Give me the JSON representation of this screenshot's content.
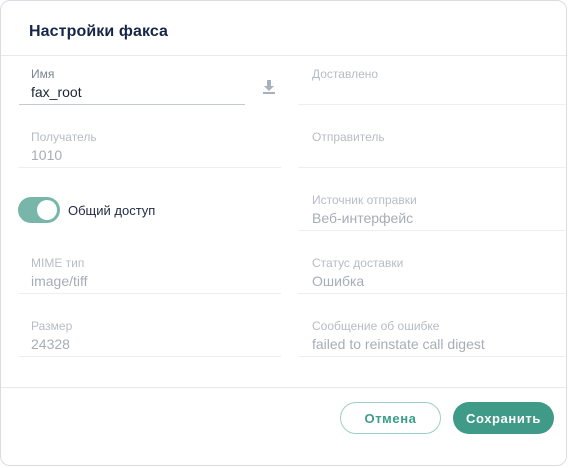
{
  "dialog": {
    "title": "Настройки факса"
  },
  "fields": {
    "name": {
      "label": "Имя",
      "value": "fax_root"
    },
    "delivered": {
      "label": "Доставлено",
      "value": ""
    },
    "recipient": {
      "label": "Получатель",
      "value": "1010"
    },
    "sender": {
      "label": "Отправитель",
      "value": ""
    },
    "send_source": {
      "label": "Источник отправки",
      "value": "Веб-интерфейс"
    },
    "mime_type": {
      "label": "MIME тип",
      "value": "image/tiff"
    },
    "delivery_status": {
      "label": "Статус доставки",
      "value": "Ошибка"
    },
    "size": {
      "label": "Размер",
      "value": "24328"
    },
    "error_message": {
      "label": "Сообщение об ошибке",
      "value": "failed to reinstate call digest"
    }
  },
  "shared_access": {
    "label": "Общий доступ",
    "enabled": true
  },
  "buttons": {
    "cancel": "Отмена",
    "save": "Сохранить"
  },
  "icons": {
    "download": "download-icon"
  },
  "colors": {
    "accent": "#3f9a87",
    "toggle": "#79b6aa",
    "title": "#16254a"
  }
}
